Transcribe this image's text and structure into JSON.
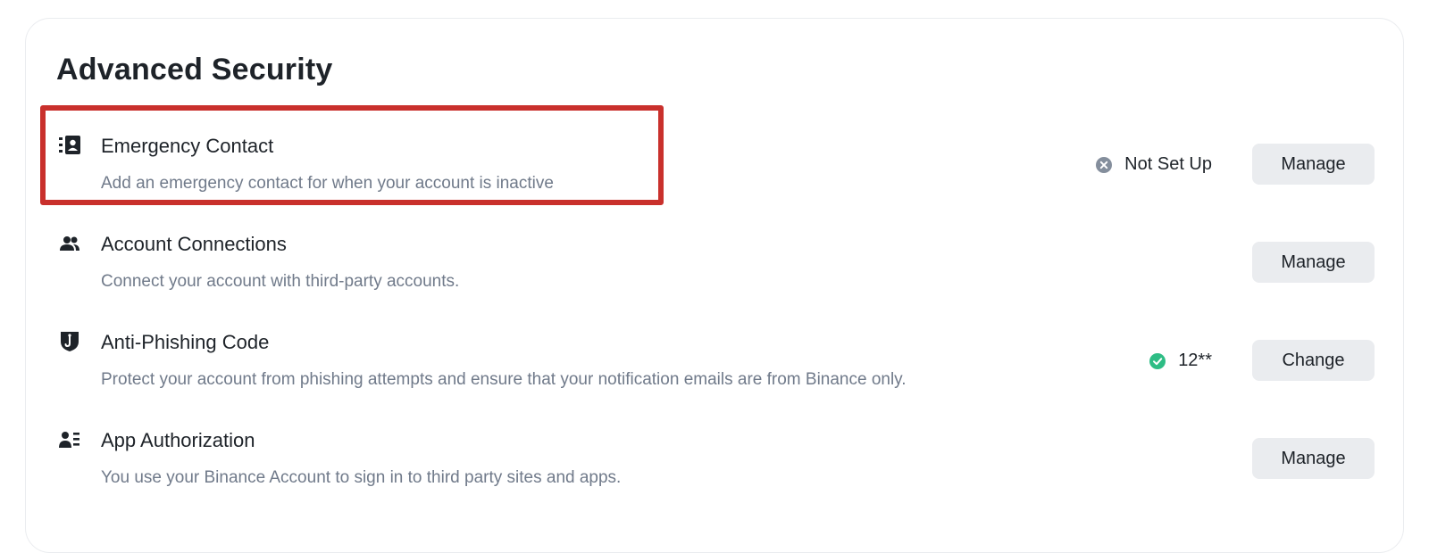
{
  "section": {
    "title": "Advanced Security"
  },
  "rows": [
    {
      "icon": "contact-book-icon",
      "title": "Emergency Contact",
      "description": "Add an emergency contact for when your account is inactive",
      "status": "Not Set Up",
      "status_icon": "x-circle-icon",
      "button": "Manage",
      "highlighted": true
    },
    {
      "icon": "people-icon",
      "title": "Account Connections",
      "description": "Connect your account with third-party accounts.",
      "button": "Manage"
    },
    {
      "icon": "shield-hook-icon",
      "title": "Anti-Phishing Code",
      "description": "Protect your account from phishing attempts and ensure that your notification emails are from Binance only.",
      "status": "12**",
      "status_icon": "check-circle-icon",
      "button": "Change"
    },
    {
      "icon": "person-list-icon",
      "title": "App Authorization",
      "description": "You use your Binance Account to sign in to third party sites and apps.",
      "button": "Manage"
    }
  ],
  "colors": {
    "text_primary": "#1e2329",
    "text_secondary": "#707a8a",
    "button_bg": "#eaecef",
    "status_ok": "#2ebd85",
    "status_none": "#848e9c",
    "highlight_border": "#c9302c"
  }
}
